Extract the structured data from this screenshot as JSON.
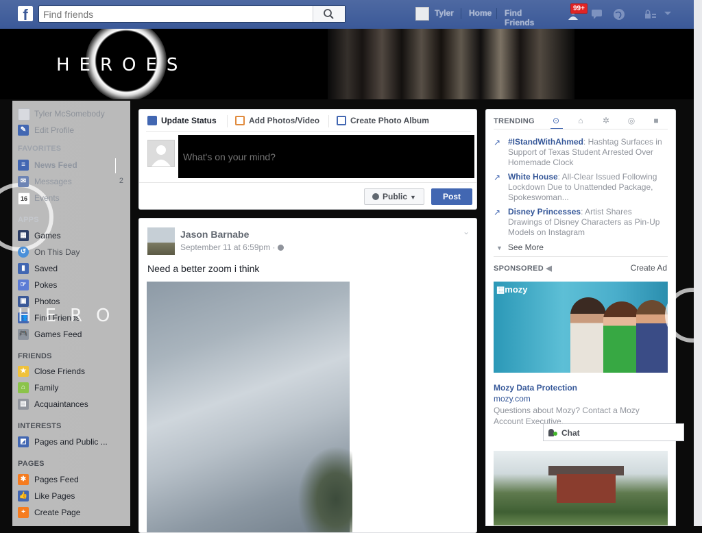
{
  "topbar": {
    "logo": "f",
    "search_placeholder": "Find friends",
    "user_name": "Tyler",
    "home": "Home",
    "find_friends": "Find Friends",
    "notification_count": "99+",
    "icons": [
      "friend-requests-icon",
      "messages-icon",
      "notifications-globe-icon",
      "privacy-shortcuts-icon",
      "account-menu-chevron-icon"
    ]
  },
  "banner": {
    "title": "HEROES"
  },
  "left_sidebar": {
    "profile_name": "Tyler McSomebody",
    "edit_profile": "Edit Profile",
    "sections": {
      "favorites": "FAVORITES",
      "apps": "APPS",
      "friends": "FRIENDS",
      "interests": "INTERESTS",
      "pages": "PAGES"
    },
    "favorites": [
      {
        "label": "News Feed",
        "icon": "news-feed-icon"
      },
      {
        "label": "Messages",
        "icon": "messages-icon",
        "count": "2"
      },
      {
        "label": "Events",
        "icon": "events-icon",
        "badge": "16"
      }
    ],
    "apps": [
      {
        "label": "Games",
        "icon": "games-icon"
      },
      {
        "label": "On This Day",
        "icon": "on-this-day-icon"
      },
      {
        "label": "Saved",
        "icon": "saved-icon"
      },
      {
        "label": "Pokes",
        "icon": "pokes-icon"
      },
      {
        "label": "Photos",
        "icon": "photos-icon"
      },
      {
        "label": "Find Friends",
        "icon": "find-friends-icon"
      },
      {
        "label": "Games Feed",
        "icon": "games-feed-icon"
      }
    ],
    "friends": [
      {
        "label": "Close Friends",
        "icon": "close-friends-icon"
      },
      {
        "label": "Family",
        "icon": "family-icon"
      },
      {
        "label": "Acquaintances",
        "icon": "acquaintances-icon"
      }
    ],
    "interests": [
      {
        "label": "Pages and Public ...",
        "icon": "pages-feed-icon"
      }
    ],
    "pages": [
      {
        "label": "Pages Feed",
        "icon": "pages-feed-megaphone-icon"
      },
      {
        "label": "Like Pages",
        "icon": "like-pages-icon"
      },
      {
        "label": "Create Page",
        "icon": "create-page-icon"
      }
    ],
    "watermark": "HERO"
  },
  "composer": {
    "tabs": [
      "Update Status",
      "Add Photos/Video",
      "Create Photo Album"
    ],
    "placeholder": "What's on your mind?",
    "audience": "Public",
    "post": "Post"
  },
  "story": {
    "author": "Jason Barnabe",
    "time": "September 11 at 6:59pm",
    "text": "Need a better zoom i think"
  },
  "trending": {
    "header": "TRENDING",
    "items": [
      {
        "title": "#IStandWithAhmed",
        "desc": ": Hashtag Surfaces in Support of Texas Student Arrested Over Homemade Clock"
      },
      {
        "title": "White House",
        "desc": ": All-Clear Issued Following Lockdown Due to Unattended Package, Spokeswoman..."
      },
      {
        "title": "Disney Princesses",
        "desc": ": Artist Shares Drawings of Disney Characters as Pin-Up Models on Instagram"
      }
    ],
    "see_more": "See More"
  },
  "sponsored": {
    "header": "SPONSORED",
    "create_ad": "Create Ad",
    "ad_logo": "mozy",
    "ad_title": "Mozy Data Protection",
    "ad_domain": "mozy.com",
    "ad_desc": "Questions about Mozy? Contact a Mozy Account Executive."
  },
  "chat": {
    "label": "Chat"
  },
  "colors": {
    "facebook_blue": "#3b5998",
    "link_blue": "#365899",
    "post_button": "#4267b2",
    "online_green": "#42b72a"
  }
}
